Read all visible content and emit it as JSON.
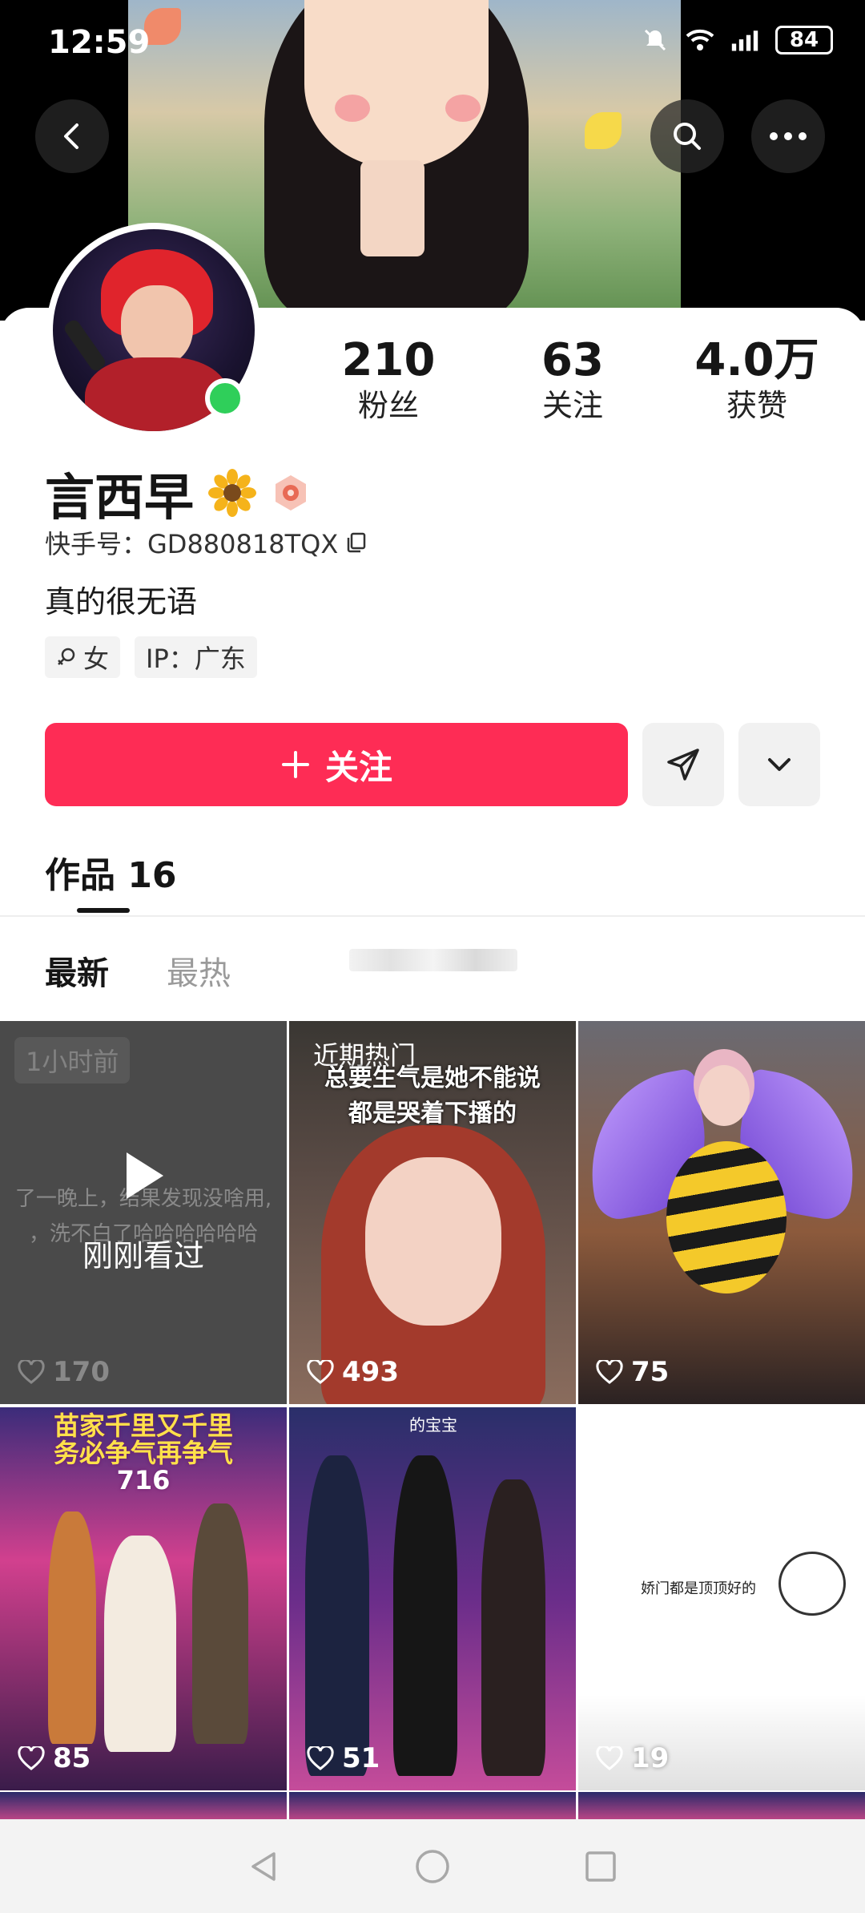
{
  "status_bar": {
    "time": "12:59",
    "battery": "84"
  },
  "profile": {
    "stats": [
      {
        "value": "210",
        "label": "粉丝"
      },
      {
        "value": "63",
        "label": "关注"
      },
      {
        "value": "4.0万",
        "label": "获赞"
      }
    ],
    "name": "言西早",
    "kuaishou_id": "快手号：GD880818TQX",
    "bio": "真的很无语",
    "tags": {
      "gender": "女",
      "ip": "IP：广东"
    }
  },
  "actions": {
    "follow_label": "关注"
  },
  "tabs": {
    "works": "作品 16"
  },
  "sort": {
    "latest": "最新",
    "hottest": "最热"
  },
  "videos": [
    {
      "time_badge": "1小时前",
      "caption_lines": [
        "了一晚上，结果发现没啥用,",
        "，洗不白了哈哈哈哈哈哈"
      ],
      "overlay": "刚刚看过",
      "likes": "170"
    },
    {
      "label": "近期热门",
      "caption_lines": [
        "总要生气是她不能说",
        "都是哭着下播的"
      ],
      "likes": "493"
    },
    {
      "likes": "75"
    },
    {
      "banner_lines": [
        "苗家千里又千里",
        "务必争气再争气",
        "716"
      ],
      "likes": "85"
    },
    {
      "top_text": "的宝宝",
      "likes": "51"
    },
    {
      "text": "娇门都是顶顶好的",
      "likes": "19"
    }
  ],
  "colors": {
    "accent": "#fe2c55",
    "online": "#2fcf5a"
  }
}
